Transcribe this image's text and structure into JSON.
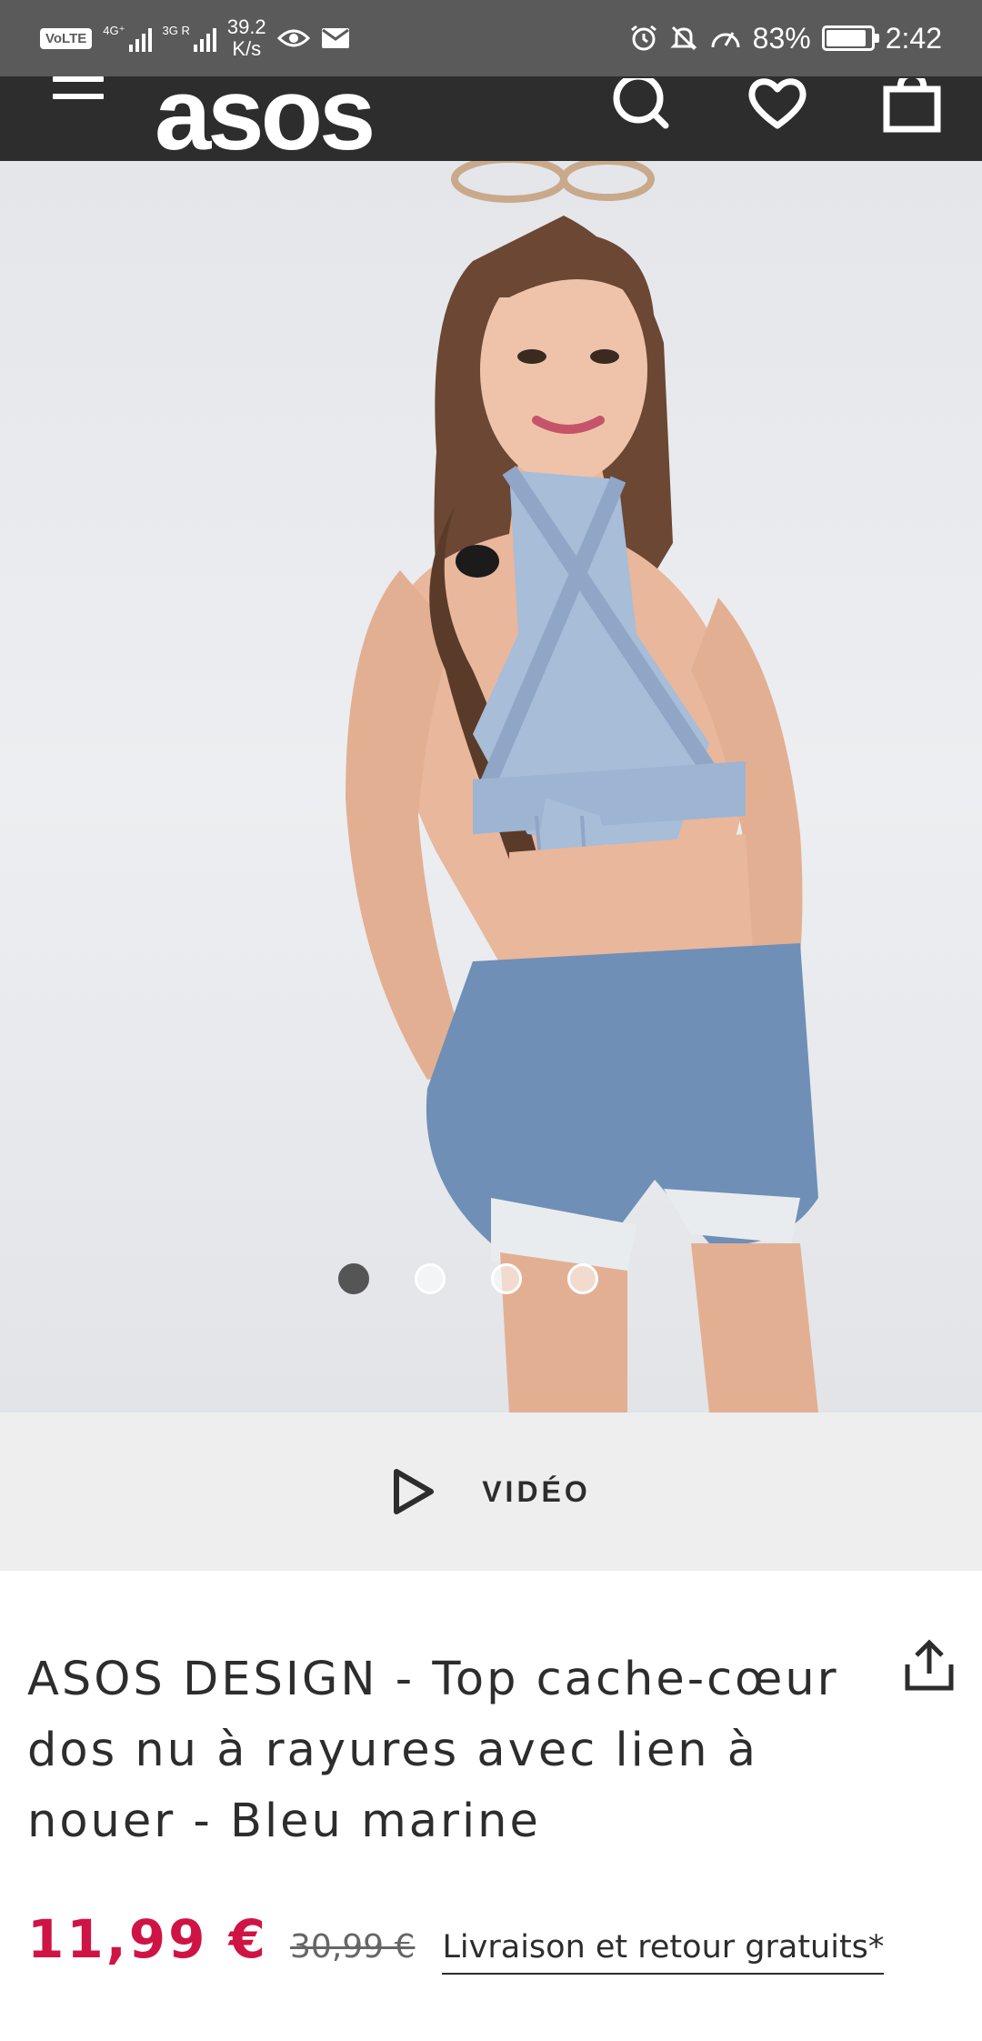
{
  "status_bar": {
    "volte": "VoLTE",
    "net1": "4G⁺",
    "net2": "3G R",
    "speed_value": "39.2",
    "speed_unit": "K/s",
    "battery": "83%",
    "time": "2:42"
  },
  "header": {
    "logo": "asos",
    "icons": [
      "menu-icon",
      "search-icon",
      "heart-icon",
      "bag-icon"
    ]
  },
  "gallery": {
    "total_images": 4,
    "active_index": 0
  },
  "video": {
    "label": "VIDÉO"
  },
  "product": {
    "title": "ASOS DESIGN - Top cache-cœur dos nu à rayures avec lien à nouer - Bleu marine",
    "price": "11,99 €",
    "old_price": "30,99 €",
    "delivery": "Livraison et retour gratuits*"
  },
  "colors": {
    "header_bg": "#2d2d2d",
    "status_bg": "#5a5a5a",
    "price": "#d01345",
    "video_bar_bg": "#eeeeee"
  }
}
